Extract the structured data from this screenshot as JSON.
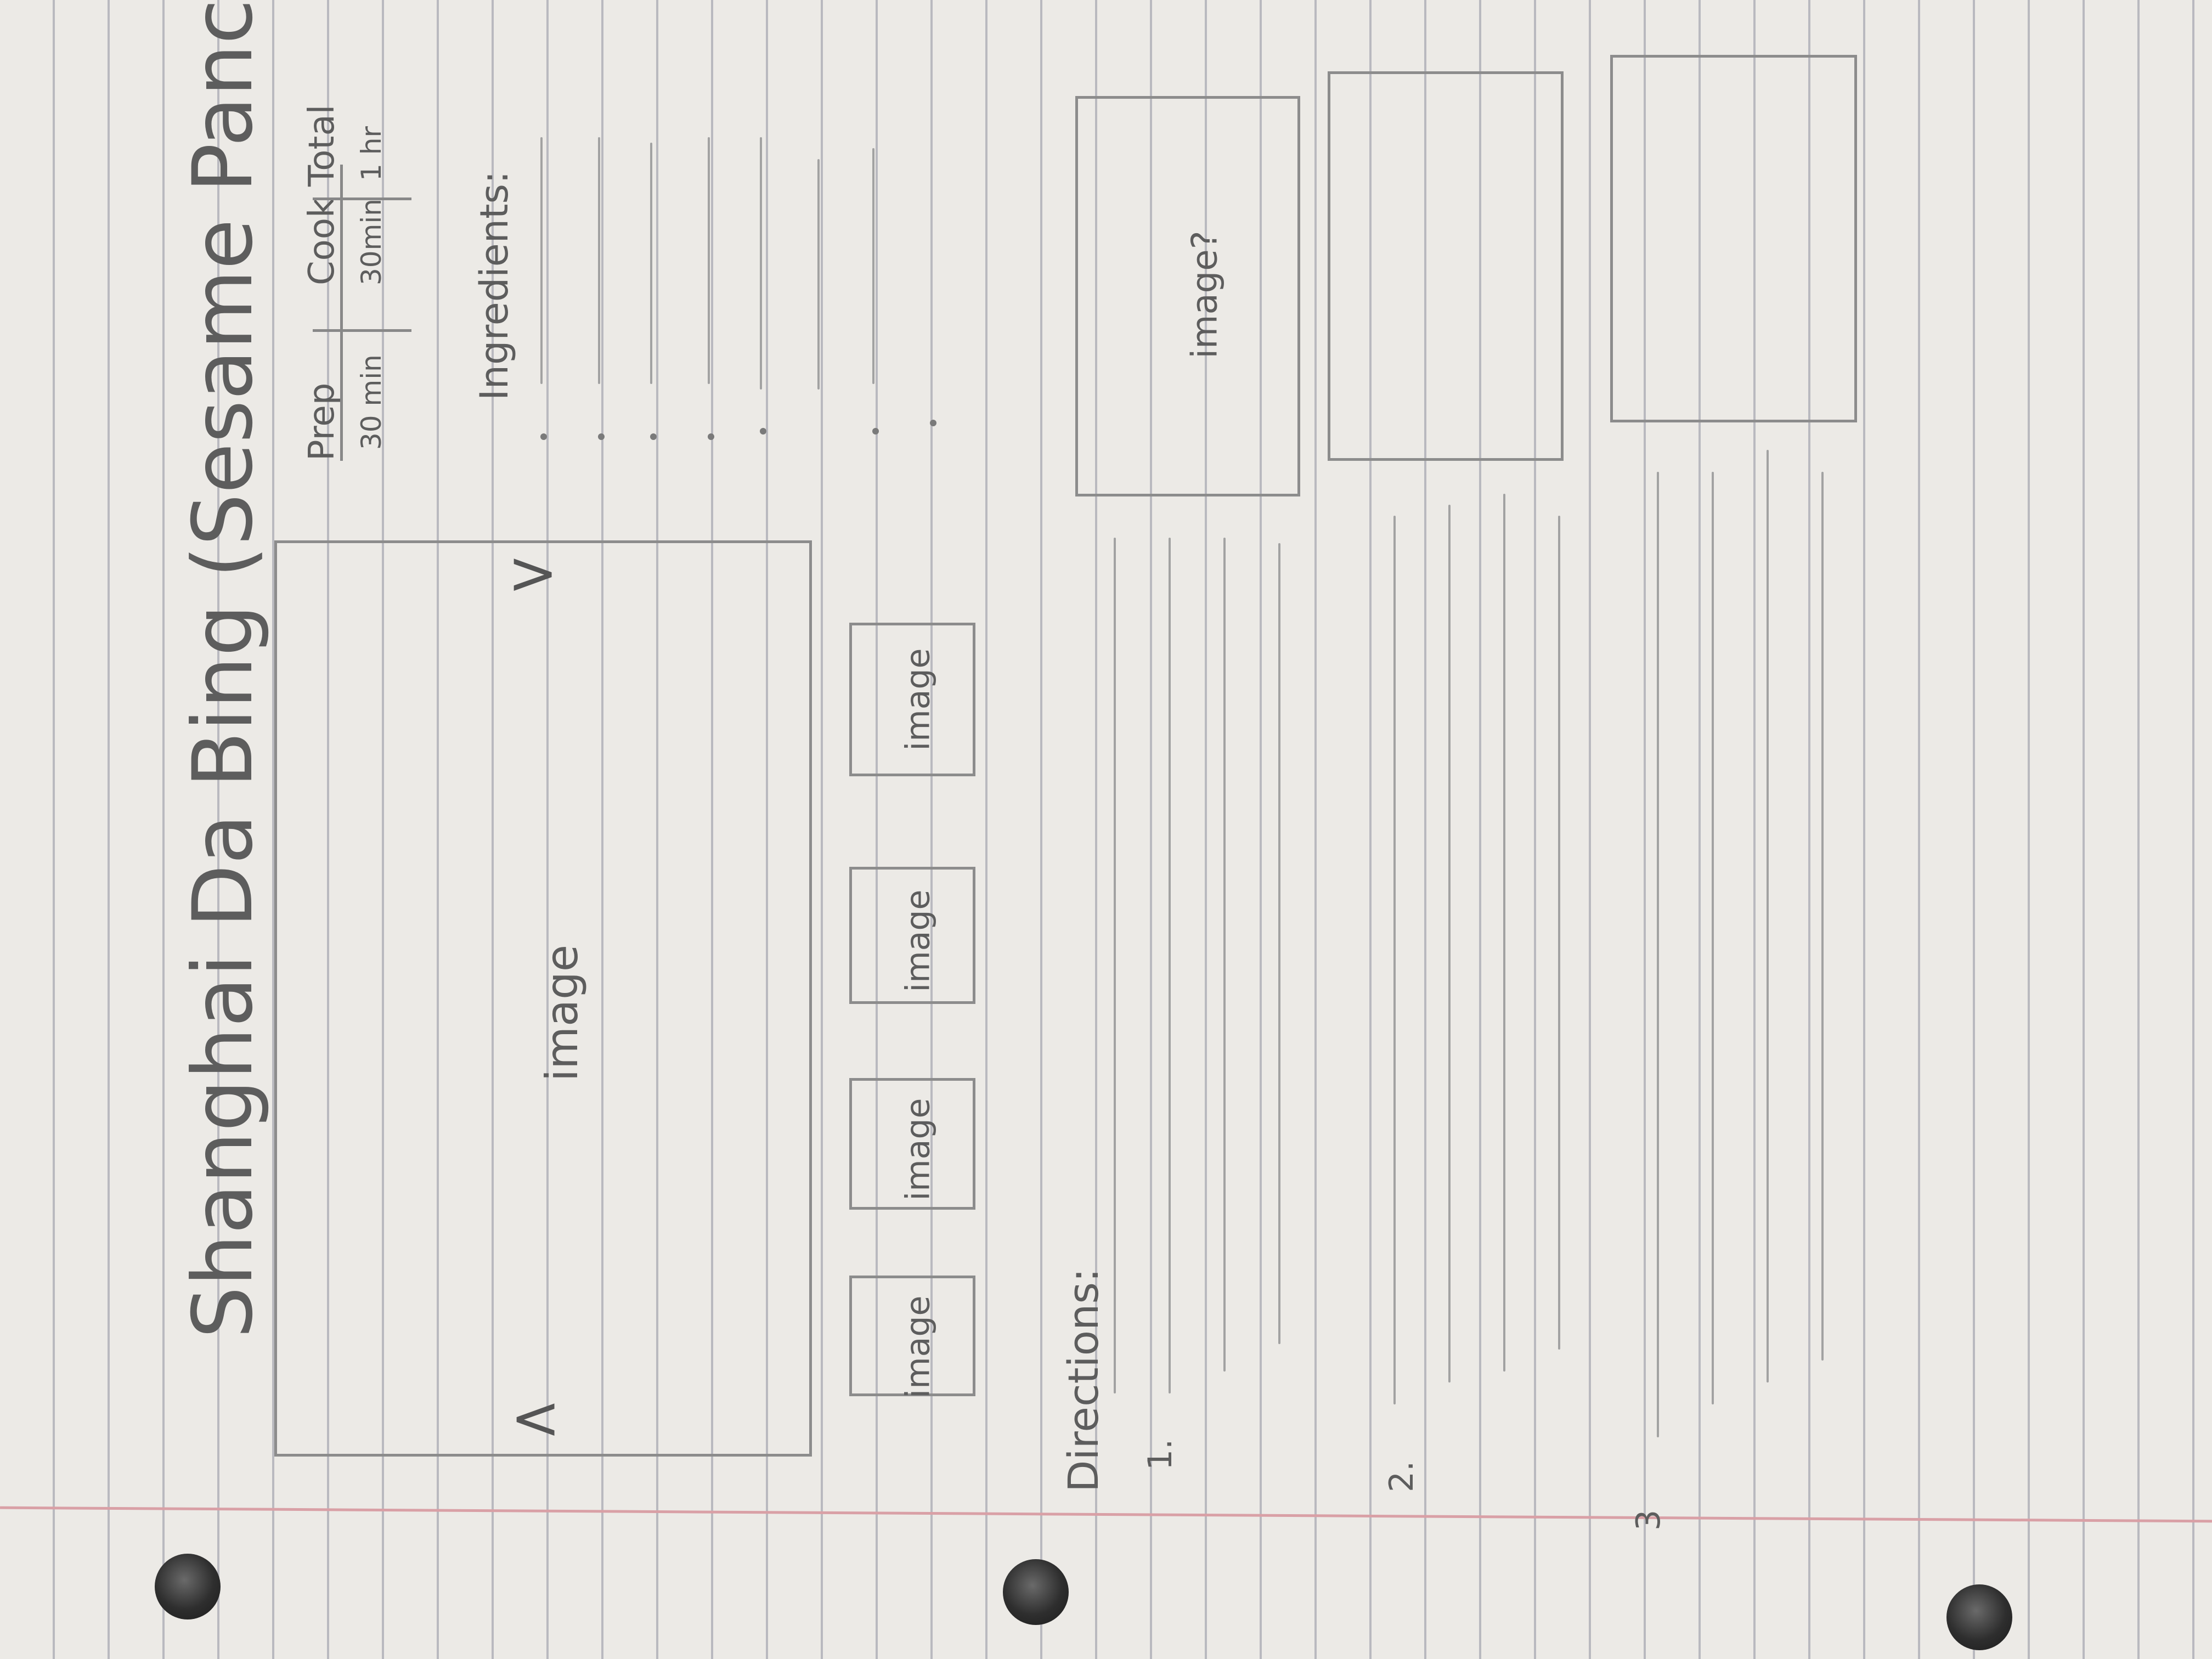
{
  "title": "Shanghai Da Bing (Sesame Pancake)",
  "hero_carousel": {
    "image_label": "image",
    "prev_arrow": "<",
    "next_arrow": ">"
  },
  "thumbnails": [
    "image",
    "image",
    "image",
    "image"
  ],
  "times": {
    "labels": [
      "Prep",
      "Cook",
      "Total"
    ],
    "values": [
      "30 min",
      "30min",
      "1 hr"
    ]
  },
  "ingredients": {
    "heading": "Ingredients:"
  },
  "directions": {
    "heading": "Directions:",
    "steps": [
      {
        "number": "1.",
        "image_label": "image?"
      },
      {
        "number": "2.",
        "image_label": ""
      },
      {
        "number": "3",
        "image_label": ""
      }
    ]
  }
}
